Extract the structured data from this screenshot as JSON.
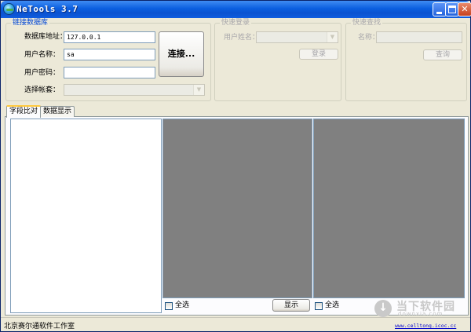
{
  "window": {
    "title": "NeTools 3.7"
  },
  "titlebar_buttons": {
    "minimize": "_",
    "maximize": "□",
    "close": "✕"
  },
  "db_group": {
    "title": "链接数据库",
    "db_address_label": "数据库地址：",
    "db_address_value": "127.0.0.1",
    "username_label": "用户名称：",
    "username_value": "sa",
    "password_label": "用户密码：",
    "password_value": "",
    "account_label": "选择帐套：",
    "account_value": "",
    "connect_button": "连接..."
  },
  "quick_login": {
    "title": "快速登录",
    "user_name_label": "用户姓名：",
    "login_button": "登录"
  },
  "quick_search": {
    "title": "快速查找",
    "name_label": "名称：",
    "search_button": "查询"
  },
  "tabs": [
    "字段比对",
    "数据显示"
  ],
  "bottom": {
    "select_all_left": "全选",
    "show_button": "显示",
    "select_all_right": "全选"
  },
  "status": {
    "company": "北京赛尔通软件工作室",
    "link": "www.celltong.icoc.cc"
  },
  "watermark": {
    "title": "当下软件园",
    "subtitle": "downxia.com"
  },
  "colors": {
    "title_bar": "#0b5fe0",
    "group_title_active": "#0046d5",
    "grid_bg": "#808080",
    "link": "#0000cc"
  }
}
